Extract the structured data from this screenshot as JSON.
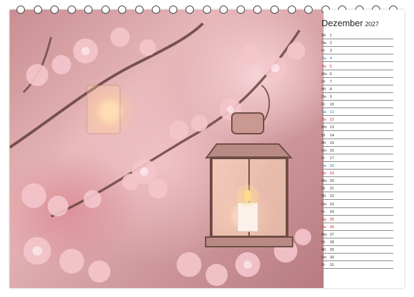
{
  "calendar": {
    "month": "Dezember",
    "year": "2027",
    "days": [
      {
        "dow": "Mi",
        "num": "1",
        "type": ""
      },
      {
        "dow": "Do",
        "num": "2",
        "type": ""
      },
      {
        "dow": "Fr",
        "num": "3",
        "type": ""
      },
      {
        "dow": "Sa",
        "num": "4",
        "type": "sat"
      },
      {
        "dow": "So",
        "num": "5",
        "type": "sun"
      },
      {
        "dow": "Mo",
        "num": "6",
        "type": ""
      },
      {
        "dow": "Di",
        "num": "7",
        "type": ""
      },
      {
        "dow": "Mi",
        "num": "8",
        "type": ""
      },
      {
        "dow": "Do",
        "num": "9",
        "type": ""
      },
      {
        "dow": "Fr",
        "num": "10",
        "type": ""
      },
      {
        "dow": "Sa",
        "num": "11",
        "type": "sat"
      },
      {
        "dow": "So",
        "num": "12",
        "type": "sun"
      },
      {
        "dow": "Mo",
        "num": "13",
        "type": ""
      },
      {
        "dow": "Di",
        "num": "14",
        "type": ""
      },
      {
        "dow": "Mi",
        "num": "15",
        "type": ""
      },
      {
        "dow": "Do",
        "num": "16",
        "type": ""
      },
      {
        "dow": "Fr",
        "num": "17",
        "type": ""
      },
      {
        "dow": "Sa",
        "num": "18",
        "type": "sat"
      },
      {
        "dow": "So",
        "num": "19",
        "type": "sun"
      },
      {
        "dow": "Mo",
        "num": "20",
        "type": ""
      },
      {
        "dow": "Di",
        "num": "21",
        "type": ""
      },
      {
        "dow": "Mi",
        "num": "22",
        "type": ""
      },
      {
        "dow": "Do",
        "num": "23",
        "type": ""
      },
      {
        "dow": "Fr",
        "num": "24",
        "type": ""
      },
      {
        "dow": "Sa",
        "num": "25",
        "type": "sun"
      },
      {
        "dow": "So",
        "num": "26",
        "type": "sun"
      },
      {
        "dow": "Mo",
        "num": "27",
        "type": ""
      },
      {
        "dow": "Di",
        "num": "28",
        "type": ""
      },
      {
        "dow": "Mi",
        "num": "29",
        "type": ""
      },
      {
        "dow": "Do",
        "num": "30",
        "type": ""
      },
      {
        "dow": "Fr",
        "num": "31",
        "type": ""
      }
    ]
  },
  "colors": {
    "saturday": "#2a7aa0",
    "sunday_holiday": "#b2222e"
  },
  "photo": {
    "subject": "cherry-blossom-lantern-photo"
  }
}
